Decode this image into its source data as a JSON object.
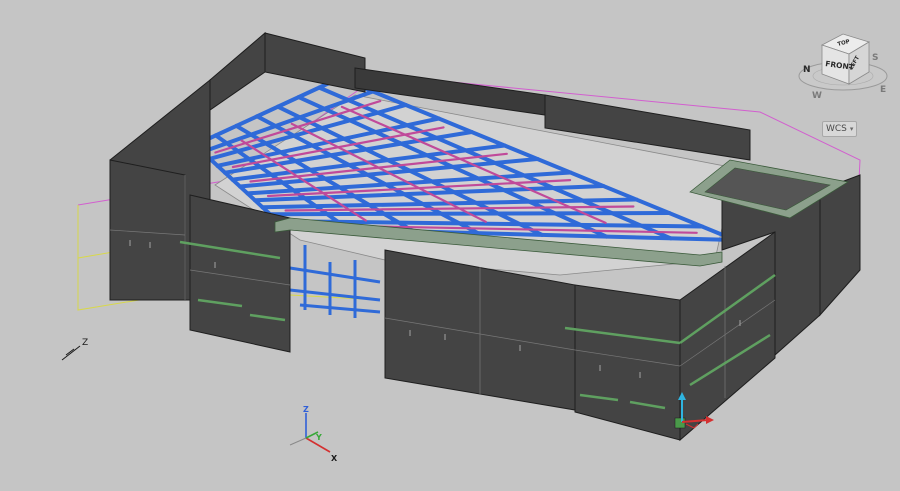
{
  "viewcube": {
    "face_front": "FRONT",
    "face_top": "TOP",
    "face_left": "LEFT",
    "compass": {
      "north": "N",
      "south": "S",
      "east": "E",
      "west": "W"
    }
  },
  "wcs_menu": {
    "label": "WCS",
    "caret": "▾"
  },
  "z_direction_label": "Z",
  "ucs_icon": {
    "x": "X",
    "y": "Y",
    "z": "Z"
  },
  "colors": {
    "background": "#c5c5c5",
    "wall": "#444444",
    "wall_edge": "#1e1e1e",
    "beam_blue": "#2f6ad8",
    "beam_magenta": "#c04a9a",
    "slab_outline_magenta": "#d25fcf",
    "slab_outline_yellow": "#d8d84a",
    "slab_green": "#5fa060",
    "axis_x": "#d43030",
    "axis_y": "#38a838",
    "axis_z": "#2f5fd8",
    "viewcube_face": "#e4e4e4"
  }
}
